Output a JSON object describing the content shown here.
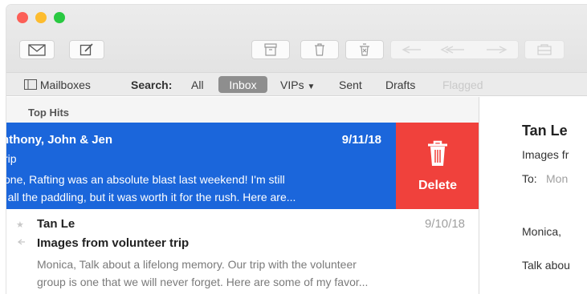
{
  "scope_bar": {
    "mailboxes_label": "Mailboxes",
    "search_label": "Search:",
    "scopes": [
      "All",
      "Inbox",
      "VIPs",
      "Sent",
      "Drafts",
      "Flagged"
    ],
    "selected_scope": "Inbox"
  },
  "message_list": {
    "section_title": "Top Hits",
    "selected_message": {
      "sender": "nthony, John & Jen",
      "date": "9/11/18",
      "subject": "rip",
      "preview_line1": "yone, Rafting was an absolute blast last weekend! I'm still",
      "preview_line2": "n all the paddling, but it was worth it for the rush. Here are..."
    },
    "swipe_action": {
      "label": "Delete",
      "icon": "trash-icon",
      "color": "#f0413c"
    },
    "second_message": {
      "sender": "Tan Le",
      "date": "9/10/18",
      "subject": "Images from volunteer trip",
      "preview_line1": "Monica, Talk about a lifelong memory. Our trip with the volunteer",
      "preview_line2": "group is one that we will never forget.  Here are some of my favor..."
    }
  },
  "reading_pane": {
    "from": "Tan Le",
    "subject": "Images fr",
    "to_label": "To:",
    "to_value": "Mon",
    "greeting": "Monica,",
    "body": "Talk abou"
  },
  "colors": {
    "selected_row": "#1b66db",
    "delete": "#f0413c",
    "inbox_pill": "#8e8e8e",
    "traffic_red": "#fc5f57",
    "traffic_yellow": "#fdbc2e",
    "traffic_green": "#29c941"
  }
}
